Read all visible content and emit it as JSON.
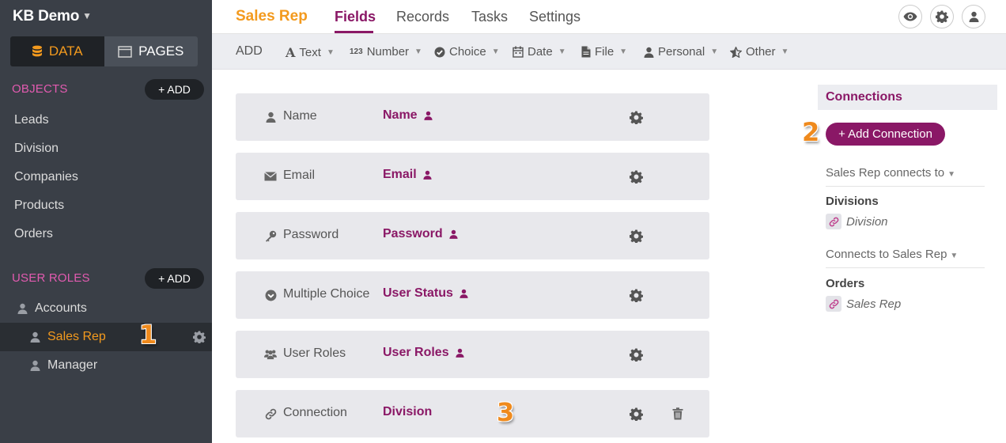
{
  "app": {
    "title": "KB Demo"
  },
  "sidebar": {
    "modes": [
      {
        "label": "DATA"
      },
      {
        "label": "PAGES"
      }
    ],
    "objects_header": "OBJECTS",
    "add_label": "+ ADD",
    "objects": [
      "Leads",
      "Division",
      "Companies",
      "Products",
      "Orders"
    ],
    "roles_header": "USER ROLES",
    "roles": [
      "Accounts",
      "Sales Rep",
      "Manager"
    ]
  },
  "markers": [
    "1",
    "2",
    "3"
  ],
  "header": {
    "object_name": "Sales Rep",
    "tabs": [
      "Fields",
      "Records",
      "Tasks",
      "Settings"
    ]
  },
  "toolbar": {
    "add": "ADD",
    "items": [
      "Text",
      "Number",
      "Choice",
      "Date",
      "File",
      "Personal",
      "Other"
    ]
  },
  "fields": [
    {
      "type": "Name",
      "name": "Name"
    },
    {
      "type": "Email",
      "name": "Email"
    },
    {
      "type": "Password",
      "name": "Password"
    },
    {
      "type": "Multiple Choice",
      "name": "User Status"
    },
    {
      "type": "User Roles",
      "name": "User Roles"
    },
    {
      "type": "Connection",
      "name": "Division"
    }
  ],
  "connections": {
    "header": "Connections",
    "add_button": "+ Add Connection",
    "outgoing_label": "Sales Rep connects to",
    "outgoing_group": "Divisions",
    "outgoing_link": "Division",
    "incoming_label": "Connects to Sales Rep",
    "incoming_group": "Orders",
    "incoming_link": "Sales Rep"
  },
  "colors": {
    "accent": "#8a1866",
    "brand_orange": "#f39a1e",
    "sidebar_bg": "#3a3f47",
    "section_pink": "#e25bb0"
  }
}
